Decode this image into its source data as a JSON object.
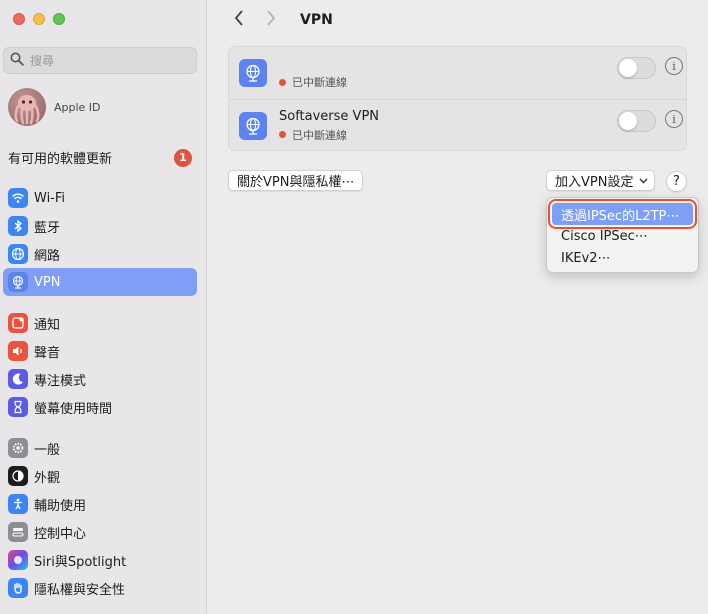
{
  "sidebar": {
    "search_placeholder": "搜尋",
    "apple_id_label": "Apple ID",
    "update_text": "有可用的軟體更新",
    "update_badge": "1",
    "group1": [
      {
        "label": "Wi-Fi",
        "icon": "wifi-icon",
        "color": "#3b86f3"
      },
      {
        "label": "藍牙",
        "icon": "bluetooth-icon",
        "color": "#3b86f3"
      },
      {
        "label": "網路",
        "icon": "globe-icon",
        "color": "#3b86f3"
      },
      {
        "label": "VPN",
        "icon": "vpn-globe-icon",
        "color": "#5c83ee",
        "active": true
      }
    ],
    "group2": [
      {
        "label": "通知",
        "icon": "bell-icon",
        "color": "#e9533f"
      },
      {
        "label": "聲音",
        "icon": "speaker-icon",
        "color": "#e9533f"
      },
      {
        "label": "專注模式",
        "icon": "moon-icon",
        "color": "#5c5ce0"
      },
      {
        "label": "螢幕使用時間",
        "icon": "hourglass-icon",
        "color": "#5c5ce0"
      }
    ],
    "group3": [
      {
        "label": "一般",
        "icon": "gear-icon",
        "color": "#8e8e93"
      },
      {
        "label": "外觀",
        "icon": "appearance-icon",
        "color": "#1d1d1f"
      },
      {
        "label": "輔助使用",
        "icon": "accessibility-icon",
        "color": "#3b86f3"
      },
      {
        "label": "控制中心",
        "icon": "control-center-icon",
        "color": "#8e8e93"
      },
      {
        "label": "Siri與Spotlight",
        "icon": "siri-icon",
        "color": "#2b2b3a"
      },
      {
        "label": "隱私權與安全性",
        "icon": "hand-icon",
        "color": "#3b86f3"
      }
    ]
  },
  "main": {
    "title": "VPN",
    "vpns": [
      {
        "name": "",
        "status": "已中斷連線"
      },
      {
        "name": "Softaverse VPN",
        "status": "已中斷連線"
      }
    ],
    "privacy_button": "關於VPN與隱私權⋯",
    "add_button": "加入VPN設定",
    "help_label": "?",
    "menu": [
      {
        "label": "透過IPSec的L2TP⋯",
        "highlighted": true
      },
      {
        "label": "Cisco IPSec⋯"
      },
      {
        "label": "IKEv2⋯"
      }
    ]
  },
  "colors": {
    "accent": "#7e9ff5",
    "badge": "#e0533e",
    "highlight_outline": "#e8522f"
  }
}
